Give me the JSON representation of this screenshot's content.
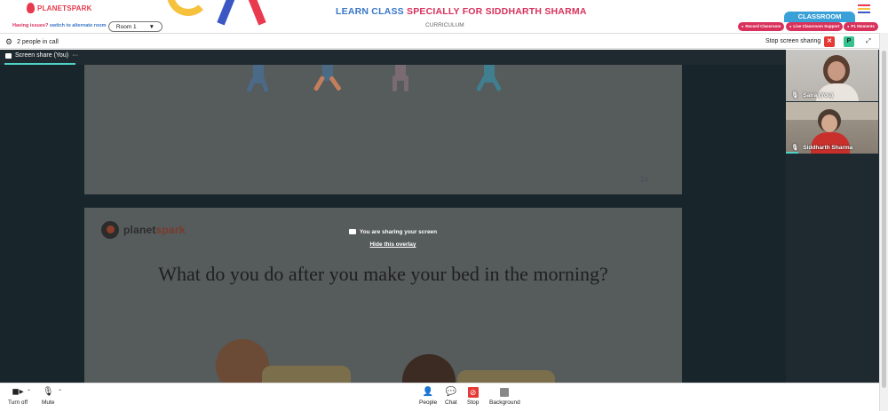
{
  "banner": {
    "logo_text": "PLANETSPARK",
    "title_part1": "LEARN CLASS ",
    "title_part2": "SPECIALLY FOR SIDDHARTH SHARMA",
    "classroom_tab": "CLASSROOM",
    "hamburger_colors": [
      "#e8394d",
      "#f6c23e",
      "#3a57c4"
    ]
  },
  "subbar": {
    "issue_text": "Having issues? ",
    "issue_link": "switch to alternate room",
    "room_label": "Room 1",
    "room_caret": "▼",
    "curriculum": "CURRICULUM",
    "buttons": [
      "Record Classroom",
      "Live Classroom Support",
      "P1 Moments"
    ]
  },
  "meetbar": {
    "people_count": "2 people in call",
    "stop_sharing": "Stop screen sharing",
    "red_btn": "✕",
    "green_btn": "P",
    "expand": "⤢"
  },
  "main": {
    "share_label": "Screen share (You)",
    "share_more": "···",
    "slide1_page": "24",
    "slide2_logo_part1": "planet",
    "slide2_logo_part2": "spark",
    "slide2_question": "What do you do after you make your bed in the morning?",
    "overlay_msg": "You are sharing your screen",
    "overlay_link": "Hide this overlay"
  },
  "participants": [
    {
      "name": "Saira (You)"
    },
    {
      "name": "Siddharth Sharma"
    }
  ],
  "controls": {
    "turn_off": "Turn off",
    "mute": "Mute",
    "people": "People",
    "chat": "Chat",
    "stop": "Stop",
    "background": "Background"
  },
  "colors": {
    "accent_red": "#d8315b",
    "accent_blue": "#3876c9",
    "teal": "#4fd1c5"
  }
}
